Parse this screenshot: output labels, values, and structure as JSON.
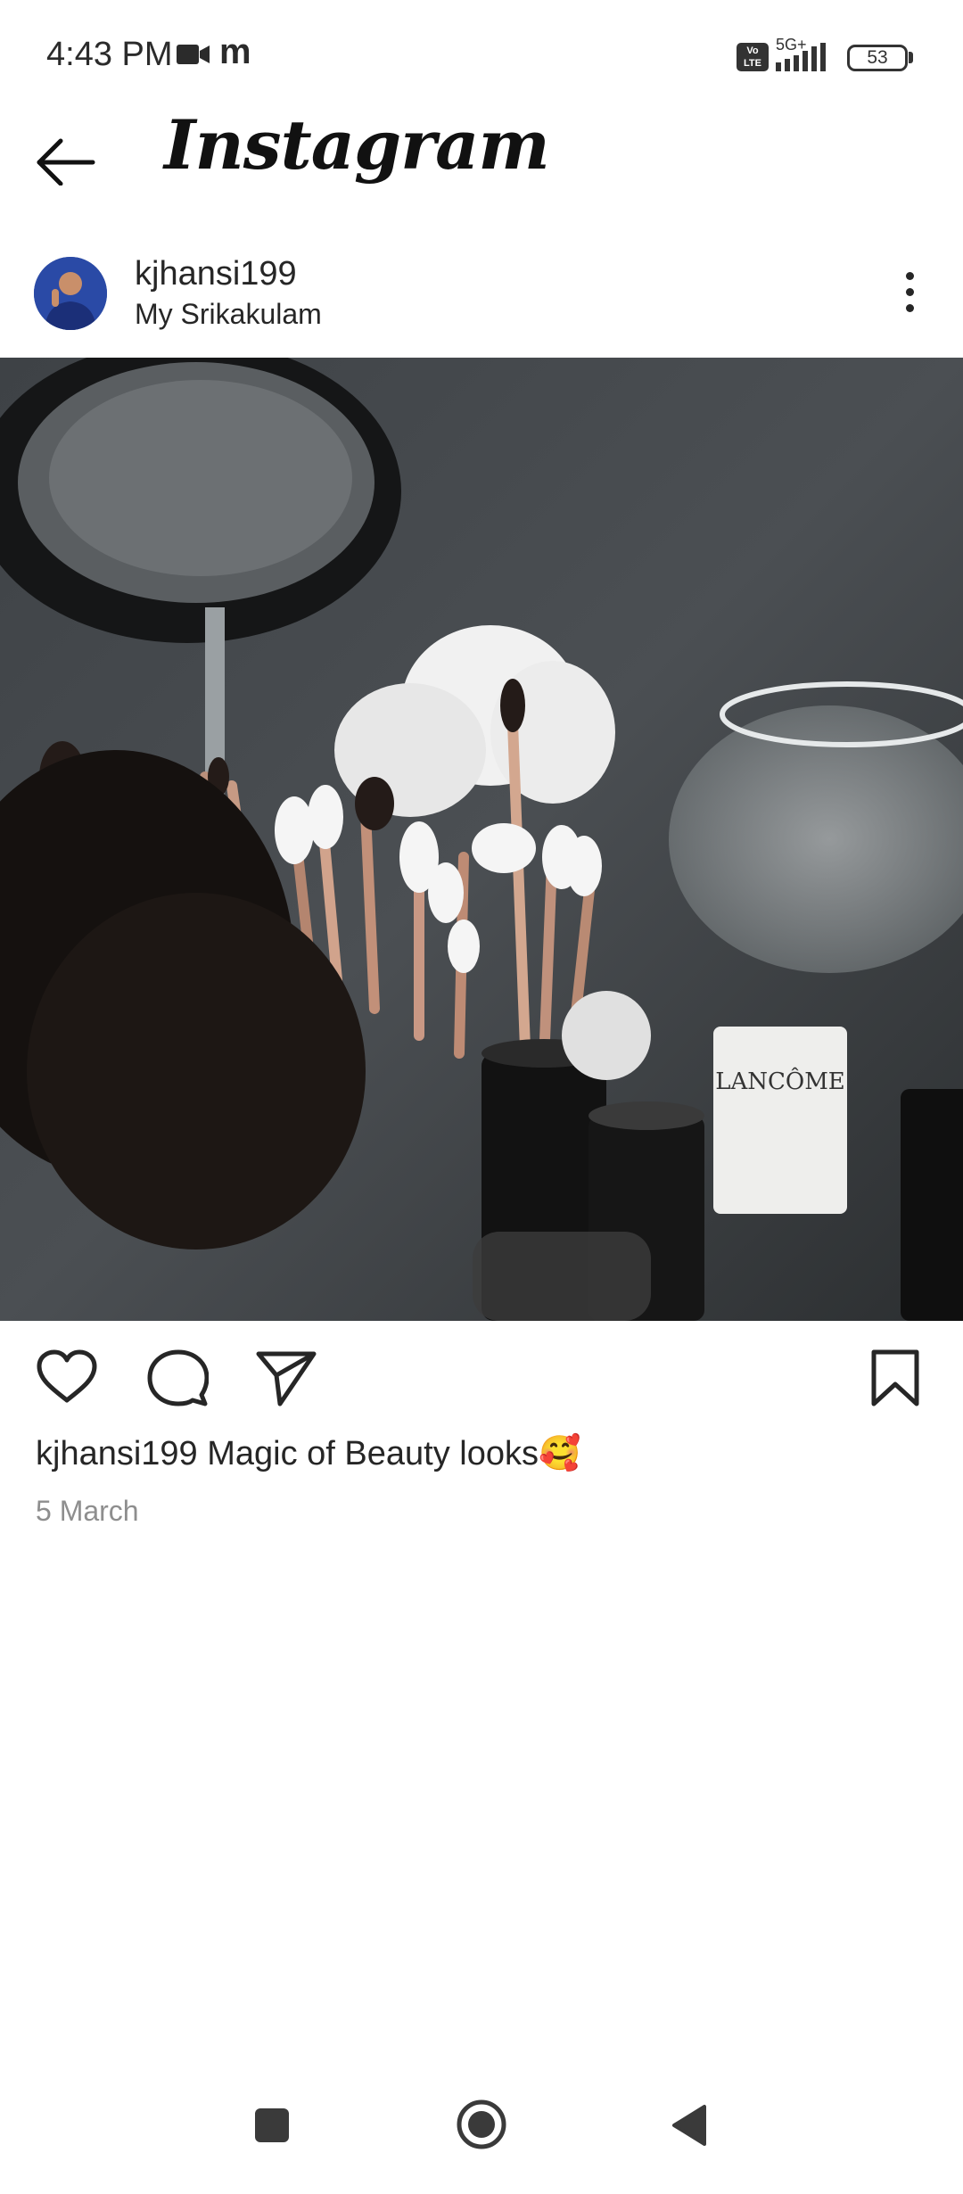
{
  "status_bar": {
    "time": "4:43 PM",
    "m_glyph": "m",
    "volte": "Vo LTE",
    "network": "5G+",
    "battery": "53"
  },
  "header": {
    "brand": "Instagram"
  },
  "post": {
    "username": "kjhansi199",
    "location": "My Srikakulam",
    "image_text": "LANCÔME",
    "caption_user": "kjhansi199",
    "caption_text": " Magic of Beauty looks🥰",
    "date": "5 March"
  },
  "icons": {
    "back": "arrow-left-icon",
    "more": "more-vertical-icon",
    "like": "heart-icon",
    "comment": "comment-icon",
    "share": "send-icon",
    "save": "bookmark-icon",
    "nav_recent": "square-icon",
    "nav_home": "circle-icon",
    "nav_back": "triangle-back-icon"
  },
  "colors": {
    "text": "#262626",
    "muted": "#8e8e8e",
    "background": "#ffffff"
  }
}
